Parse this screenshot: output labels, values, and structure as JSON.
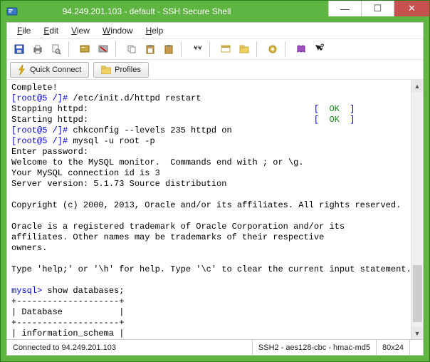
{
  "window": {
    "title": "94.249.201.103 - default - SSH Secure Shell"
  },
  "menu": {
    "file": "File",
    "edit": "Edit",
    "view": "View",
    "window": "Window",
    "help": "Help"
  },
  "toolbar2": {
    "quick_connect": "Quick Connect",
    "profiles": "Profiles"
  },
  "terminal": {
    "l01": "Complete!",
    "l02a": "[root@5 /]#",
    "l02b": " /etc/init.d/httpd restart",
    "l03a": "Stopping httpd:                                            ",
    "l03b": "[  ",
    "l03c": "OK",
    "l03d": "  ]",
    "l04a": "Starting httpd:                                            ",
    "l04b": "[  ",
    "l04c": "OK",
    "l04d": "  ]",
    "l05a": "[root@5 /]#",
    "l05b": " chkconfig --levels 235 httpd on",
    "l06a": "[root@5 /]#",
    "l06b": " mysql -u root -p",
    "l07": "Enter password:",
    "l08": "Welcome to the MySQL monitor.  Commands end with ; or \\g.",
    "l09": "Your MySQL connection id is 3",
    "l10": "Server version: 5.1.73 Source distribution",
    "l11": "",
    "l12": "Copyright (c) 2000, 2013, Oracle and/or its affiliates. All rights reserved.",
    "l13": "",
    "l14": "Oracle is a registered trademark of Oracle Corporation and/or its",
    "l15": "affiliates. Other names may be trademarks of their respective",
    "l16": "owners.",
    "l17": "",
    "l18": "Type 'help;' or '\\h' for help. Type '\\c' to clear the current input statement.",
    "l19": "",
    "l20a": "mysql>",
    "l20b": " show databases;",
    "l21": "+--------------------+",
    "l22": "| Database           |",
    "l23": "+--------------------+",
    "l24": "| information_schema |"
  },
  "status": {
    "connected": "Connected to 94.249.201.103",
    "ssh": "SSH2 - aes128-cbc - hmac-md5",
    "size": "80x24"
  }
}
